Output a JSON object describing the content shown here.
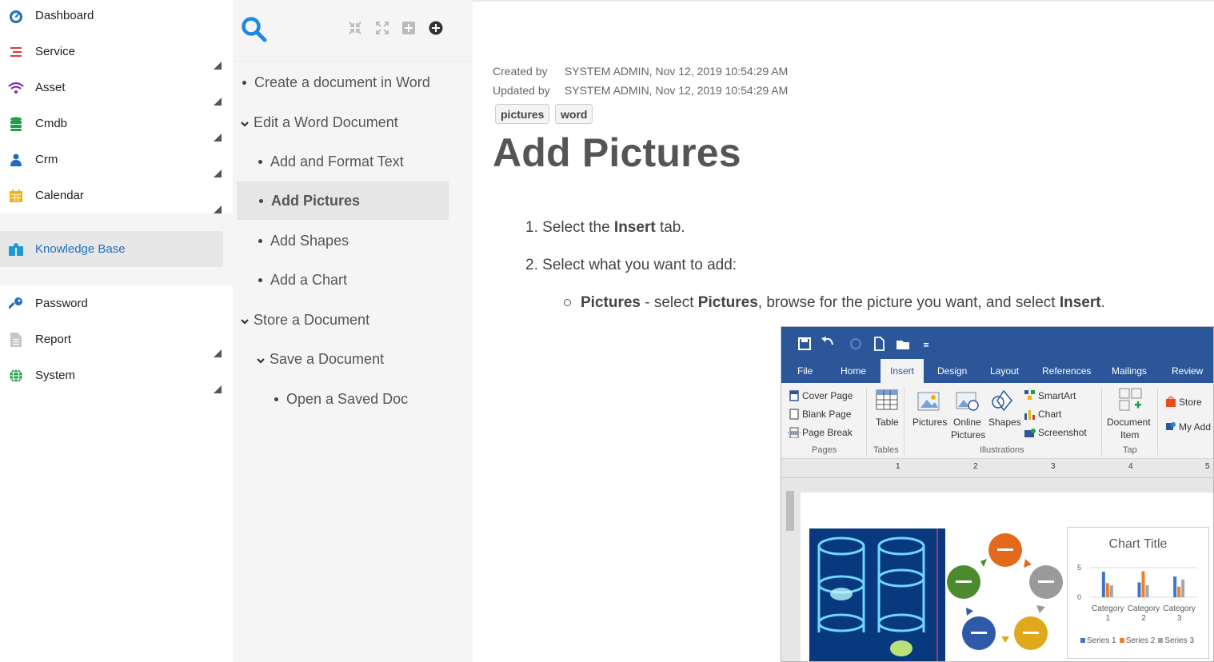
{
  "sidebar": {
    "items": [
      {
        "label": "Dashboard",
        "icon": "dashboard-icon",
        "color": "#1f6fbf",
        "has_submenu": false
      },
      {
        "label": "Service",
        "icon": "service-icon",
        "color": "#e03b3b",
        "has_submenu": true
      },
      {
        "label": "Asset",
        "icon": "wifi-icon",
        "color": "#7b2fbf",
        "has_submenu": true
      },
      {
        "label": "Cmdb",
        "icon": "database-icon",
        "color": "#1e9e46",
        "has_submenu": true
      },
      {
        "label": "Crm",
        "icon": "user-icon",
        "color": "#1f6fbf",
        "has_submenu": true
      },
      {
        "label": "Calendar",
        "icon": "calendar-icon",
        "color": "#f2b418",
        "has_submenu": true
      },
      {
        "label": "Knowledge Base",
        "icon": "knowledge-base-icon",
        "color": "#1a9ad6",
        "active": true
      },
      {
        "label": "Password",
        "icon": "key-icon",
        "color": "#1f6fbf",
        "has_submenu": false
      },
      {
        "label": "Report",
        "icon": "report-icon",
        "color": "#999999",
        "has_submenu": true
      },
      {
        "label": "System",
        "icon": "globe-icon",
        "color": "#1e9e46",
        "has_submenu": true
      }
    ]
  },
  "tree": {
    "toolbar": {
      "search": "search-icon",
      "buttons": [
        "collapse-icon",
        "expand-icon",
        "add-square-icon",
        "add-circle-icon"
      ]
    },
    "nodes": [
      {
        "label": "Create a document in Word",
        "level": 0,
        "type": "leaf"
      },
      {
        "label": "Edit a Word Document",
        "level": 0,
        "type": "expanded"
      },
      {
        "label": "Add and Format Text",
        "level": 1,
        "type": "leaf"
      },
      {
        "label": "Add Pictures",
        "level": 1,
        "type": "leaf",
        "active": true
      },
      {
        "label": "Add Shapes",
        "level": 1,
        "type": "leaf"
      },
      {
        "label": "Add a Chart",
        "level": 1,
        "type": "leaf"
      },
      {
        "label": "Store a Document",
        "level": 0,
        "type": "expanded"
      },
      {
        "label": "Save a Document",
        "level": 1,
        "type": "expanded"
      },
      {
        "label": "Open a Saved Doc",
        "level": 2,
        "type": "leaf"
      }
    ]
  },
  "article": {
    "created_label": "Created by",
    "created_value": "SYSTEM ADMIN, Nov 12, 2019 10:54:29 AM",
    "updated_label": "Updated by",
    "updated_value": "SYSTEM ADMIN, Nov 12, 2019 10:54:29 AM",
    "tags": [
      "pictures",
      "word"
    ],
    "title": "Add Pictures",
    "step1": {
      "num": "1.",
      "pre": "Select the ",
      "bold": "Insert",
      "post": " tab."
    },
    "step2": {
      "num": "2.",
      "text": "Select what you want to add:"
    },
    "substep": {
      "b1": "Pictures",
      "t1": " - select ",
      "b2": "Pictures",
      "t2": ", browse for the picture you want, and select ",
      "b3": "Insert",
      "t3": "."
    }
  },
  "word_screenshot": {
    "tabs": [
      "File",
      "Home",
      "Insert",
      "Design",
      "Layout",
      "References",
      "Mailings",
      "Review"
    ],
    "selected_tab": "Insert",
    "pages_group": {
      "items": [
        "Cover Page",
        "Blank Page",
        "Page Break"
      ],
      "label": "Pages"
    },
    "tables_group": {
      "item": "Table",
      "label": "Tables"
    },
    "illustrations_group": {
      "pictures": "Pictures",
      "online_1": "Online",
      "online_2": "Pictures",
      "shapes": "Shapes",
      "smartart": "SmartArt",
      "chart": "Chart",
      "screenshot": "Screenshot",
      "label": "Illustrations"
    },
    "tap_group": {
      "item_1": "Document",
      "item_2": "Item",
      "label": "Tap"
    },
    "addins_group": {
      "store": "Store",
      "myadd": "My Add"
    },
    "ruler_numbers": [
      "1",
      "2",
      "3",
      "4",
      "5"
    ],
    "colors": {
      "word_blue": "#2b579a"
    }
  },
  "chart_data": {
    "type": "bar",
    "title": "Chart Title",
    "categories": [
      "Category 1",
      "Category 2",
      "Category 3"
    ],
    "series": [
      {
        "name": "Series 1",
        "values": [
          4.3,
          2.5,
          3.5
        ],
        "color": "#4472c4"
      },
      {
        "name": "Series 2",
        "values": [
          2.4,
          4.4,
          1.8
        ],
        "color": "#ed7d31"
      },
      {
        "name": "Series 3",
        "values": [
          2.0,
          2.0,
          3.0
        ],
        "color": "#a5a5a5"
      }
    ],
    "ylim": [
      0,
      5
    ],
    "yticks": [
      "5",
      "0"
    ],
    "legend": "bottom"
  }
}
